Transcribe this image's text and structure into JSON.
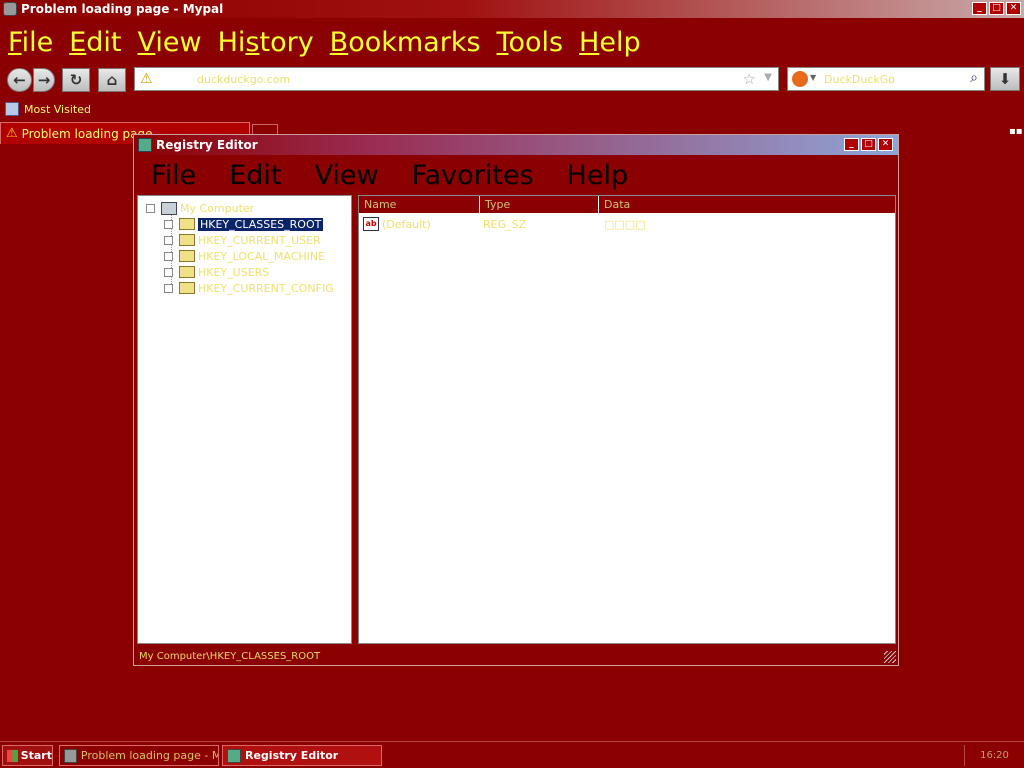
{
  "browser": {
    "title": "Problem loading page - Mypal",
    "menu": [
      "File",
      "Edit",
      "View",
      "History",
      "Bookmarks",
      "Tools",
      "Help"
    ],
    "menu_accel": [
      "F",
      "E",
      "V",
      "s",
      "B",
      "T",
      "H"
    ],
    "url": "duckduckgo.com",
    "search_placeholder": "DuckDuckGo",
    "bookmarks": {
      "most_visited": "Most Visited"
    },
    "tab_label": "Problem loading page"
  },
  "regedit": {
    "title": "Registry Editor",
    "menu": [
      "File",
      "Edit",
      "View",
      "Favorites",
      "Help"
    ],
    "tree_root": "My Computer",
    "tree_items": [
      "HKEY_CLASSES_ROOT",
      "HKEY_CURRENT_USER",
      "HKEY_LOCAL_MACHINE",
      "HKEY_USERS",
      "HKEY_CURRENT_CONFIG"
    ],
    "columns": [
      "Name",
      "Type",
      "Data"
    ],
    "rows": [
      {
        "name": "(Default)",
        "type": "REG_SZ",
        "data": "□□□□"
      }
    ],
    "status": "My Computer\\HKEY_CLASSES_ROOT"
  },
  "taskbar": {
    "start": "Start",
    "tasks": [
      "Problem loading page - M...",
      "Registry Editor"
    ],
    "clock": "16:20"
  }
}
